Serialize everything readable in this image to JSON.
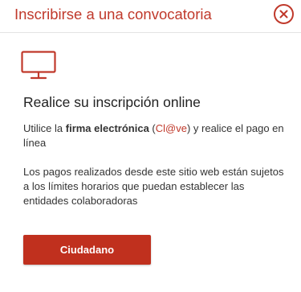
{
  "modal": {
    "title": "Inscribirse a una convocatoria",
    "close_icon": "close-circle-icon"
  },
  "content": {
    "icon": "monitor-icon",
    "heading": "Realice su inscripción online",
    "para1": {
      "prefix": "Utilice la ",
      "bold": "firma electrónica",
      "space_paren_open": " (",
      "clave": "Cl@ve",
      "suffix": ") y realice el pago en línea"
    },
    "para2": "Los pagos realizados desde este sitio web están sujetos a los límites horarios que puedan establecer las entidades colaboradoras"
  },
  "actions": {
    "primary_label": "Ciudadano"
  },
  "colors": {
    "accent": "#c0392b",
    "button_bg": "#c0301e",
    "text": "#333333",
    "divider": "#e4e4e4"
  }
}
